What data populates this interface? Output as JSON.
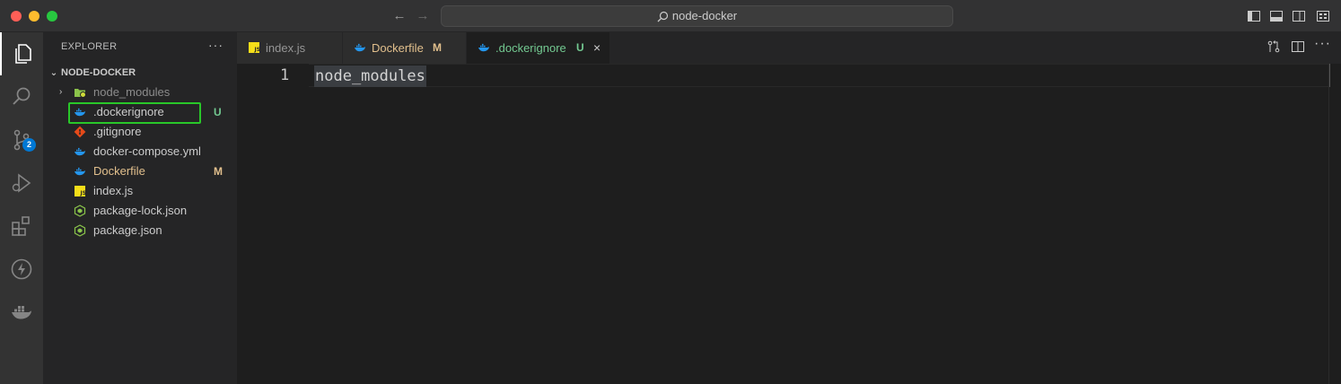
{
  "window": {
    "search_label": "node-docker"
  },
  "activity_bar": {
    "scm_badge": "2"
  },
  "explorer": {
    "header": "EXPLORER",
    "more": "···",
    "root_label": "NODE-DOCKER",
    "items": [
      {
        "label": "node_modules",
        "status": "",
        "color": "#8c8c8c",
        "icon": "folder-icon"
      },
      {
        "label": ".dockerignore",
        "status": "U",
        "color": "#cccccc",
        "icon": "docker-icon"
      },
      {
        "label": ".gitignore",
        "status": "",
        "color": "#cccccc",
        "icon": "git-icon"
      },
      {
        "label": "docker-compose.yml",
        "status": "",
        "color": "#cccccc",
        "icon": "docker-icon"
      },
      {
        "label": "Dockerfile",
        "status": "M",
        "color": "#e2c08d",
        "icon": "docker-icon"
      },
      {
        "label": "index.js",
        "status": "",
        "color": "#cccccc",
        "icon": "js-icon"
      },
      {
        "label": "package-lock.json",
        "status": "",
        "color": "#cccccc",
        "icon": "nodejs-icon"
      },
      {
        "label": "package.json",
        "status": "",
        "color": "#cccccc",
        "icon": "nodejs-icon"
      }
    ],
    "status_colors": {
      "U": "#73c991",
      "M": "#e2c08d"
    }
  },
  "tabs": [
    {
      "label": "index.js",
      "status": "",
      "active": false
    },
    {
      "label": "Dockerfile",
      "status": "M",
      "active": false
    },
    {
      "label": ".dockerignore",
      "status": "U",
      "active": true
    }
  ],
  "editor": {
    "lines": [
      {
        "number": "1",
        "text": "node_modules"
      }
    ]
  }
}
